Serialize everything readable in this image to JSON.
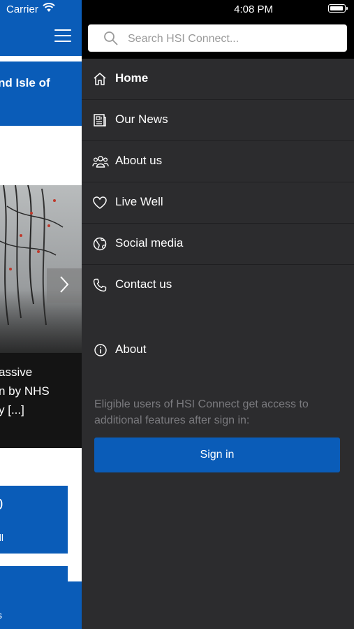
{
  "status_bar": {
    "carrier": "Carrier",
    "time": "4:08 PM",
    "battery_level": 1.0
  },
  "main_page": {
    "banner_text": "nd Isle of",
    "hero_caption_lines": [
      "assive",
      "n by NHS",
      "y [...]"
    ],
    "card_value": "0",
    "card_label": "ell",
    "bottom_label": "s"
  },
  "search": {
    "placeholder": "Search HSI Connect..."
  },
  "menu": {
    "items": [
      {
        "label": "Home",
        "icon": "home-icon"
      },
      {
        "label": "Our News",
        "icon": "news-icon"
      },
      {
        "label": "About us",
        "icon": "people-icon"
      },
      {
        "label": "Live Well",
        "icon": "heart-icon"
      },
      {
        "label": "Social media",
        "icon": "globe-icon"
      },
      {
        "label": "Contact us",
        "icon": "phone-icon"
      }
    ],
    "about_label": "About"
  },
  "sign_in": {
    "description": "Eligible users of HSI Connect get access to additional features after sign in:",
    "button_label": "Sign in"
  },
  "colors": {
    "accent": "#0a5cb8",
    "drawer_bg": "#2c2c2e"
  }
}
